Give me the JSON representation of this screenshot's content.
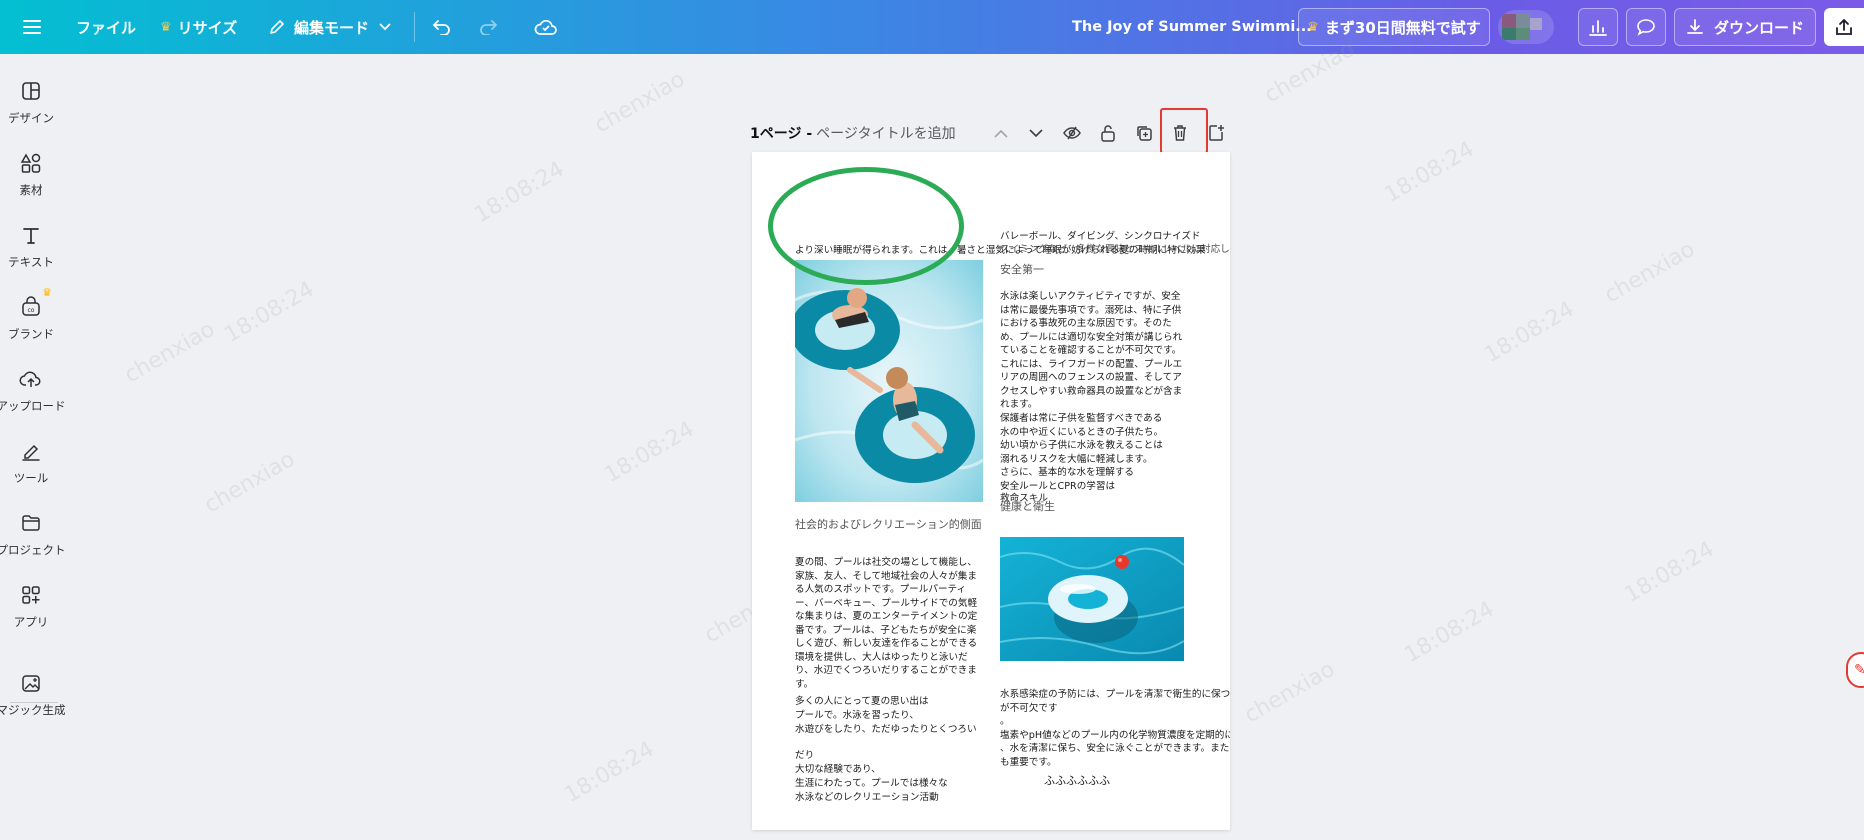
{
  "topbar": {
    "menu_icon": "hamburger-menu-icon",
    "file_label": "ファイル",
    "resize_label": "リサイズ",
    "edit_mode_label": "編集モード",
    "doc_title": "The Joy of Summer Swimmi...",
    "trial_label": "まず30日間無料で試す",
    "download_label": "ダウンロード",
    "gradient_start": "#03bfd2",
    "gradient_end": "#7a5be8",
    "crown_color": "#ffc83d"
  },
  "rail": {
    "items": [
      {
        "label": "デザイン",
        "icon": "layout-icon"
      },
      {
        "label": "素材",
        "icon": "shapes-icon"
      },
      {
        "label": "テキスト",
        "icon": "text-icon"
      },
      {
        "label": "ブランド",
        "icon": "brand-icon"
      },
      {
        "label": "アップロード",
        "icon": "cloud-upload-icon"
      },
      {
        "label": "ツール",
        "icon": "pen-tool-icon"
      },
      {
        "label": "プロジェクト",
        "icon": "folder-icon"
      },
      {
        "label": "アプリ",
        "icon": "apps-grid-icon"
      },
      {
        "label": "マジック生成",
        "icon": "magic-image-icon"
      }
    ]
  },
  "page_header": {
    "page_number": "1ページ -",
    "page_title_placeholder": "ページタイトルを追加"
  },
  "watermark": {
    "name": "chenxiao",
    "time": "18:08:24"
  },
  "document": {
    "left_col_top": "より深い睡眠が得られます。これは、暑さと湿気によって睡眠が妨げられる夏の時期に特に効果",
    "right_col_top": [
      "バレーボール、ダイビング、シンクロナイズド",
      "スイミングなど、多様な興味とスキルレベルに対応しています。",
      "安全第一"
    ],
    "safety_paragraph": [
      "水泳は楽しいアクティビティですが、安全",
      "は常に最優先事項です。溺死は、特に子供",
      "における事故死の主な原因です。そのた",
      "め、プールには適切な安全対策が講じられ",
      "ていることを確認することが不可欠です。",
      "これには、ライフガードの配置、プールエ",
      "リアの周囲へのフェンスの設置、そしてア",
      "クセスしやすい救命器具の設置などが含ま",
      "れます。"
    ],
    "supervision_paragraph": [
      "保護者は常に子供を監督すべきである",
      "水の中や近くにいるときの子供たち。",
      "幼い頃から子供に水泳を教えることは",
      "溺れるリスクを大幅に軽減します。",
      "さらに、基本的な水を理解する",
      "安全ルールとCPRの学習は",
      "救命スキル"
    ],
    "health_heading": "健康と衛生",
    "social_heading": "社会的およびレクリエーション的側面",
    "social_paragraph": [
      "夏の間、プールは社交の場として機能し、",
      "家族、友人、そして地域社会の人々が集ま",
      "る人気のスポットです。プールパーティ",
      "ー、バーベキュー、プールサイドでの気軽",
      "な集まりは、夏のエンターテイメントの定",
      "番です。プールは、子どもたちが安全に楽",
      "しく遊び、新しい友達を作ることができる",
      "環境を提供し、大人はゆったりと泳いだ",
      "り、水辺でくつろいだりすることができま",
      "す。"
    ],
    "memories_paragraph": [
      "多くの人にとって夏の思い出は",
      "プールで。水泳を習ったり、",
      "水遊びをしたり、ただゆったりとくつろい",
      "",
      "だり",
      "大切な経験であり、",
      "生涯にわたって。プールでは様々な",
      "水泳などのレクリエーション活動"
    ],
    "hygiene_paragraph": [
      "水系感染症の予防には、プールを清潔で衛生的に保つこと",
      "が不可欠です",
      "。",
      "塩素やpH値などのプール内の化学物質濃度を定期的に",
      "、水を清潔に保ち、安全に泳ぐことができます。また",
      "も重要です。"
    ],
    "footer_text": "ふふふふふふ"
  }
}
